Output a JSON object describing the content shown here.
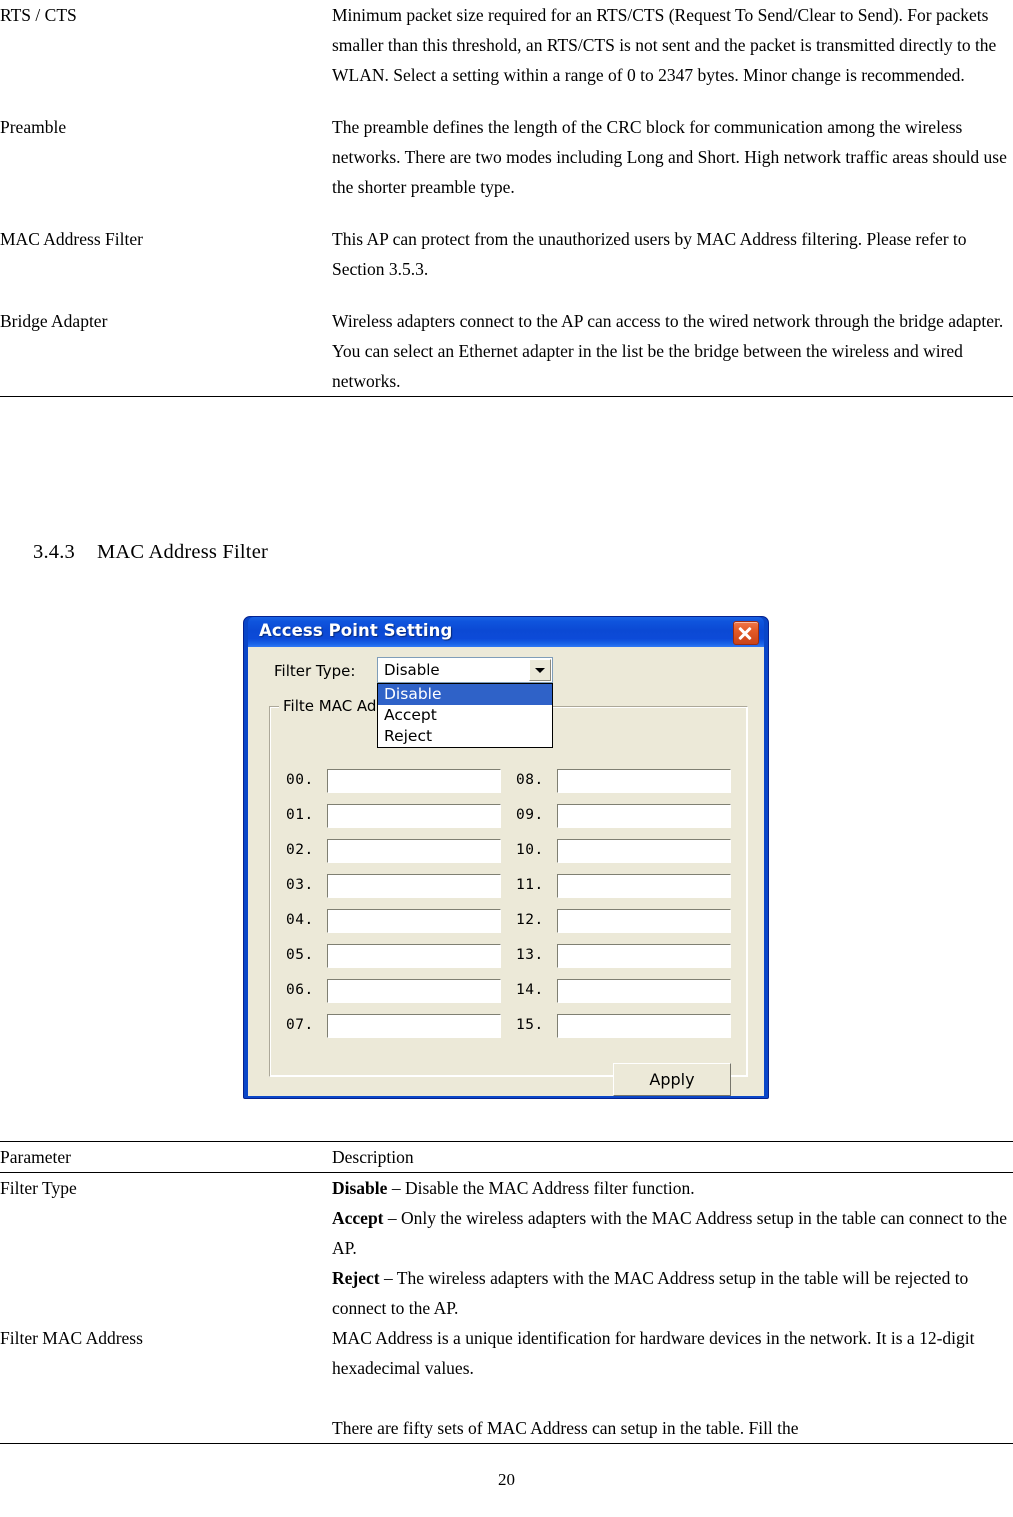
{
  "page": {
    "number": "20"
  },
  "top_table": {
    "rows": [
      {
        "parameter": "RTS / CTS",
        "description": "Minimum packet size required for an RTS/CTS (Request To Send/Clear to Send). For packets smaller than this threshold, an RTS/CTS is not sent and the packet is transmitted directly to the WLAN. Select a setting within a range of 0 to 2347 bytes. Minor change is recommended."
      },
      {
        "parameter": "Preamble",
        "description": "The preamble defines the length of the CRC block for communication among the wireless networks. There are two modes including Long and Short. High network traffic areas should use the shorter preamble type."
      },
      {
        "parameter": "MAC Address Filter",
        "description": "This AP can protect from the unauthorized users by MAC Address filtering. Please refer to Section 3.5.3."
      },
      {
        "parameter": "Bridge Adapter",
        "description": "Wireless adapters connect to the AP can access to the wired network through the bridge adapter. You can select an Ethernet adapter in the list be the bridge between the wireless and wired networks."
      }
    ]
  },
  "section": {
    "number": "3.4.3",
    "title": "MAC Address Filter"
  },
  "dialog": {
    "title": "Access Point Setting",
    "close_icon": "close-icon",
    "filter_type": {
      "label": "Filter Type:",
      "value": "Disable",
      "options": [
        "Disable",
        "Accept",
        "Reject"
      ],
      "selected_index": 0,
      "dropdown_arrow_icon": "chevron-down-icon"
    },
    "group_title": "Filte MAC Ad",
    "mac_entries_left": [
      "00.",
      "01.",
      "02.",
      "03.",
      "04.",
      "05.",
      "06.",
      "07."
    ],
    "mac_entries_right": [
      "08.",
      "09.",
      "10.",
      "11.",
      "12.",
      "13.",
      "14.",
      "15."
    ],
    "mac_values_left": [
      "",
      "",
      "",
      "",
      "",
      "",
      "",
      ""
    ],
    "mac_values_right": [
      "",
      "",
      "",
      "",
      "",
      "",
      "",
      ""
    ],
    "apply_label": "Apply",
    "colors": {
      "titlebar": "#0b49d4",
      "face": "#ece9d8",
      "highlight": "#2f62c8",
      "close": "#e35a27"
    }
  },
  "bottom_table": {
    "headers": {
      "parameter": "Parameter",
      "description": "Description"
    },
    "rows": [
      {
        "parameter": "Filter Type",
        "lines": [
          {
            "bold": "Disable",
            "rest": " – Disable the MAC Address filter function."
          },
          {
            "bold": "Accept",
            "rest": " – Only the wireless adapters with the MAC Address setup in the table can connect to the AP."
          },
          {
            "bold": "Reject",
            "rest": " – The wireless adapters with the MAC Address setup in the table will be rejected to connect to the AP."
          }
        ]
      },
      {
        "parameter": "Filter MAC Address",
        "paragraphs": [
          "MAC Address is a unique identification for hardware devices in the network. It is a 12-digit hexadecimal values.",
          "There are fifty sets of MAC Address can setup in the table. Fill the"
        ]
      }
    ]
  }
}
